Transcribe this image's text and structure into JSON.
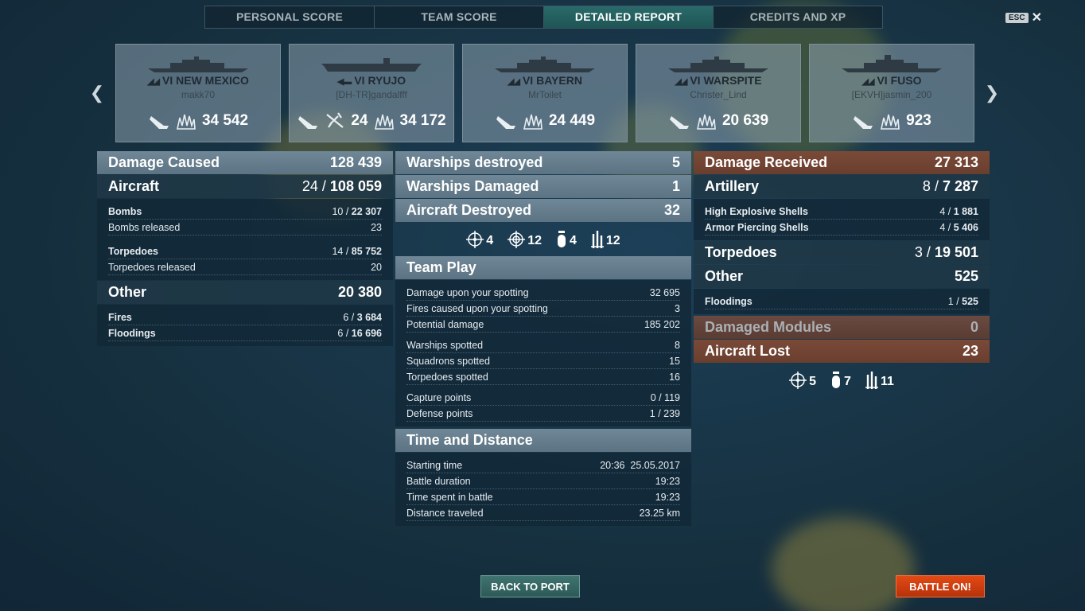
{
  "tabs": [
    "PERSONAL SCORE",
    "TEAM SCORE",
    "DETAILED REPORT",
    "CREDITS AND XP"
  ],
  "active_tab": "DETAILED REPORT",
  "esc_label": "ESC",
  "ships": [
    {
      "tier": "VI",
      "name": "NEW MEXICO",
      "player": "makk70",
      "planes_shot": "",
      "damage": "34 542"
    },
    {
      "tier": "VI",
      "name": "RYUJO",
      "player": "[DH-TR]gandalfff",
      "planes_shot": "24",
      "damage": "34 172"
    },
    {
      "tier": "VI",
      "name": "BAYERN",
      "player": "MrToilet",
      "planes_shot": "",
      "damage": "24 449"
    },
    {
      "tier": "VI",
      "name": "WARSPITE",
      "player": "Christer_Lind",
      "planes_shot": "",
      "damage": "20 639"
    },
    {
      "tier": "VI",
      "name": "FUSO",
      "player": "[EKVH]jasmin_200",
      "planes_shot": "",
      "damage": "923"
    }
  ],
  "left": {
    "damage_caused": {
      "label": "Damage Caused",
      "value": "128 439"
    },
    "aircraft": {
      "label": "Aircraft",
      "count": "24",
      "value": "108 059"
    },
    "bombs": {
      "label": "Bombs",
      "count": "10",
      "value": "22 307"
    },
    "bombs_released": {
      "label": "Bombs released",
      "value": "23"
    },
    "torpedoes": {
      "label": "Torpedoes",
      "count": "14",
      "value": "85 752"
    },
    "torpedoes_released": {
      "label": "Torpedoes released",
      "value": "20"
    },
    "other": {
      "label": "Other",
      "value": "20 380"
    },
    "fires": {
      "label": "Fires",
      "count": "6",
      "value": "3 684"
    },
    "floodings": {
      "label": "Floodings",
      "count": "6",
      "value": "16 696"
    }
  },
  "mid": {
    "warships_destroyed": {
      "label": "Warships destroyed",
      "value": "5"
    },
    "warships_damaged": {
      "label": "Warships Damaged",
      "value": "1"
    },
    "aircraft_destroyed": {
      "label": "Aircraft Destroyed",
      "value": "32"
    },
    "aircraft_icons": {
      "fighter": "4",
      "attack": "12",
      "bomber": "4",
      "torpedo": "12"
    },
    "team_play": {
      "title": "Team Play",
      "rows": [
        {
          "label": "Damage upon your spotting",
          "value": "32 695"
        },
        {
          "label": "Fires caused upon your spotting",
          "value": "3"
        },
        {
          "label": "Potential damage",
          "value": "185 202"
        },
        {
          "label": "Warships spotted",
          "value": "8"
        },
        {
          "label": "Squadrons spotted",
          "value": "15"
        },
        {
          "label": "Torpedoes spotted",
          "value": "16"
        },
        {
          "label": "Capture points",
          "value": "0 / 119"
        },
        {
          "label": "Defense points",
          "value": "1 / 239"
        }
      ]
    },
    "time_distance": {
      "title": "Time and Distance",
      "rows": [
        {
          "label": "Starting time",
          "value": "20:36  25.05.2017"
        },
        {
          "label": "Battle duration",
          "value": "19:23"
        },
        {
          "label": "Time spent in battle",
          "value": "19:23"
        },
        {
          "label": "Distance traveled",
          "value": "23.25 km"
        }
      ]
    }
  },
  "right": {
    "damage_received": {
      "label": "Damage Received",
      "value": "27 313"
    },
    "artillery": {
      "label": "Artillery",
      "count": "8",
      "value": "7 287"
    },
    "he_shells": {
      "label": "High Explosive Shells",
      "count": "4",
      "value": "1 881"
    },
    "ap_shells": {
      "label": "Armor Piercing Shells",
      "count": "4",
      "value": "5 406"
    },
    "torpedoes": {
      "label": "Torpedoes",
      "count": "3",
      "value": "19 501"
    },
    "other": {
      "label": "Other",
      "value": "525"
    },
    "floodings": {
      "label": "Floodings",
      "count": "1",
      "value": "525"
    },
    "damaged_modules": {
      "label": "Damaged Modules",
      "value": "0"
    },
    "aircraft_lost": {
      "label": "Aircraft Lost",
      "value": "23"
    },
    "lost_icons": {
      "fighter": "5",
      "bomber": "7",
      "torpedo": "11"
    }
  },
  "buttons": {
    "back_to_port": "BACK TO PORT",
    "battle_on": "BATTLE ON!"
  },
  "colors": {
    "active_tab": "#2a6a6a",
    "battle_button": "#e24a15",
    "received_header": "#7a4a38"
  }
}
